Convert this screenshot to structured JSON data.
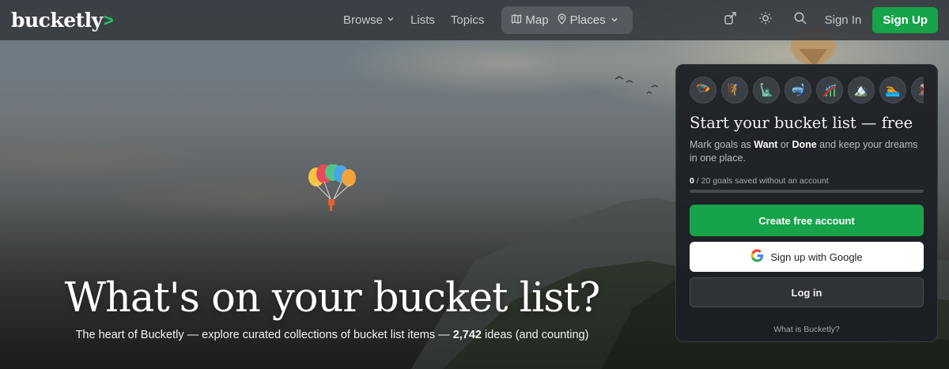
{
  "brand": {
    "name": "bucketly",
    "chevron": ">"
  },
  "nav": {
    "browse": "Browse",
    "lists": "Lists",
    "topics": "Topics",
    "map": "Map",
    "places": "Places",
    "sign_in": "Sign In",
    "sign_up": "Sign Up"
  },
  "hero": {
    "title": "What's on your bucket list?",
    "subtitle_pre": "The heart of Bucketly — explore curated collections of bucket list items — ",
    "count": "2,742",
    "subtitle_post": " ideas (and counting)"
  },
  "card": {
    "emojis": [
      "🪂",
      "🧗",
      "🗽",
      "🤿",
      "🎢",
      "🏔️",
      "🏊",
      "🌋"
    ],
    "title": "Start your bucket list — free",
    "desc_1": "Mark goals as ",
    "desc_want": "Want",
    "desc_2": " or ",
    "desc_done": "Done",
    "desc_3": " and keep your dreams in one place.",
    "progress_count": "0",
    "progress_text": " / 20 goals saved without an account",
    "progress_fraction": 0,
    "create_account": "Create free account",
    "google": "Sign up with Google",
    "login": "Log in",
    "what_is": "What is Bucketly?"
  },
  "colors": {
    "accent": "#16a34a",
    "nav_bg": "#34383c",
    "card_bg": "#1c1f23"
  },
  "icons": [
    "map-icon",
    "map-pin-icon",
    "chevron-down-icon",
    "share-icon",
    "sun-icon",
    "search-icon",
    "google-icon"
  ]
}
